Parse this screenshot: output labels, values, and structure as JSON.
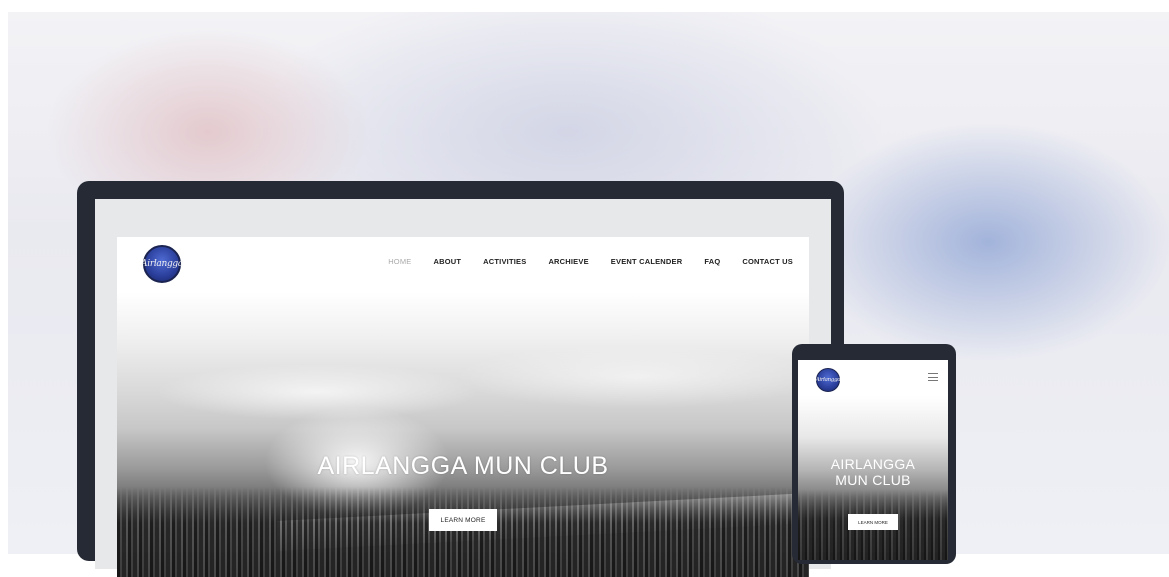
{
  "desktop": {
    "logo_text": "Airlangga",
    "nav": [
      "HOME",
      "ABOUT",
      "ACTIVITIES",
      "ARCHIEVE",
      "EVENT CALENDER",
      "FAQ",
      "CONTACT US"
    ],
    "active_nav": "HOME",
    "hero_title": "AIRLANGGA MUN CLUB",
    "cta_label": "LEARN MORE"
  },
  "mobile": {
    "logo_text": "Airlangga",
    "menu_icon": "hamburger-menu-icon",
    "hero_title_line1": "AIRLANGGA",
    "hero_title_line2": "MUN CLUB",
    "cta_label": "LEARN MORE"
  },
  "colors": {
    "device_frame": "#262a35",
    "logo_blue": "#2a3e9a",
    "nav_active": "#aaaaaa"
  }
}
